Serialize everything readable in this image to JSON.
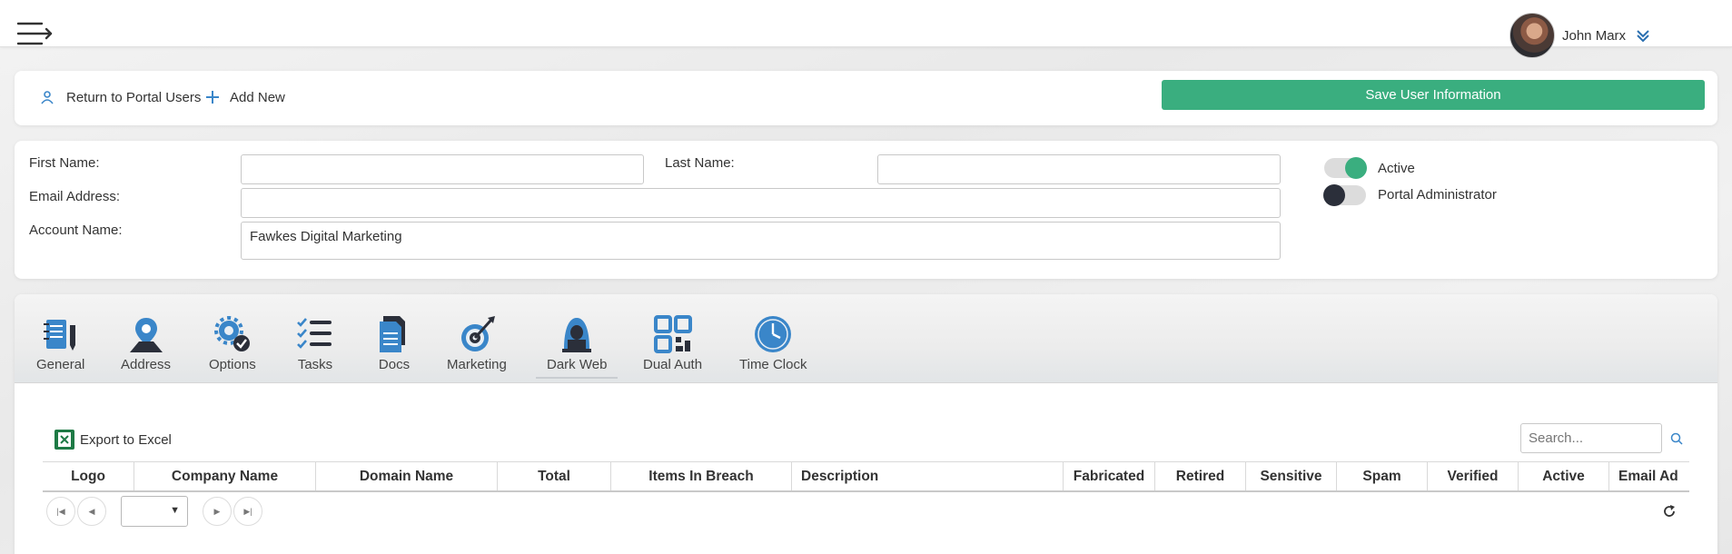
{
  "header": {
    "user_name": "John Marx",
    "menu_icon": "hamburger-menu-icon",
    "chevron_icon": "double-chevron-down-icon"
  },
  "actions": {
    "return_label": "Return to Portal Users",
    "add_new_label": "Add New",
    "save_label": "Save User Information",
    "save_color": "#3aae7f"
  },
  "form": {
    "first_name_label": "First Name:",
    "first_name_value": "",
    "last_name_label": "Last Name:",
    "last_name_value": "",
    "email_label": "Email Address:",
    "email_value": "",
    "account_label": "Account Name:",
    "account_value": "Fawkes Digital Marketing",
    "active_label": "Active",
    "active_on": true,
    "admin_label": "Portal Administrator",
    "admin_on": false
  },
  "tabs": [
    {
      "label": "General",
      "icon": "notebook-pen-icon"
    },
    {
      "label": "Address",
      "icon": "map-pin-icon"
    },
    {
      "label": "Options",
      "icon": "gear-check-icon"
    },
    {
      "label": "Tasks",
      "icon": "checklist-icon"
    },
    {
      "label": "Docs",
      "icon": "documents-icon"
    },
    {
      "label": "Marketing",
      "icon": "target-dart-icon"
    },
    {
      "label": "Dark Web",
      "icon": "hacker-laptop-icon",
      "selected": true
    },
    {
      "label": "Dual Auth",
      "icon": "qr-code-icon"
    },
    {
      "label": "Time Clock",
      "icon": "clock-icon"
    }
  ],
  "grid": {
    "export_label": "Export to Excel",
    "search_placeholder": "Search...",
    "columns": [
      "Logo",
      "Company Name",
      "Domain Name",
      "Total",
      "Items In Breach",
      "Description",
      "Fabricated",
      "Retired",
      "Sensitive",
      "Spam",
      "Verified",
      "Active",
      "Email Ad"
    ],
    "page_size_value": ""
  }
}
